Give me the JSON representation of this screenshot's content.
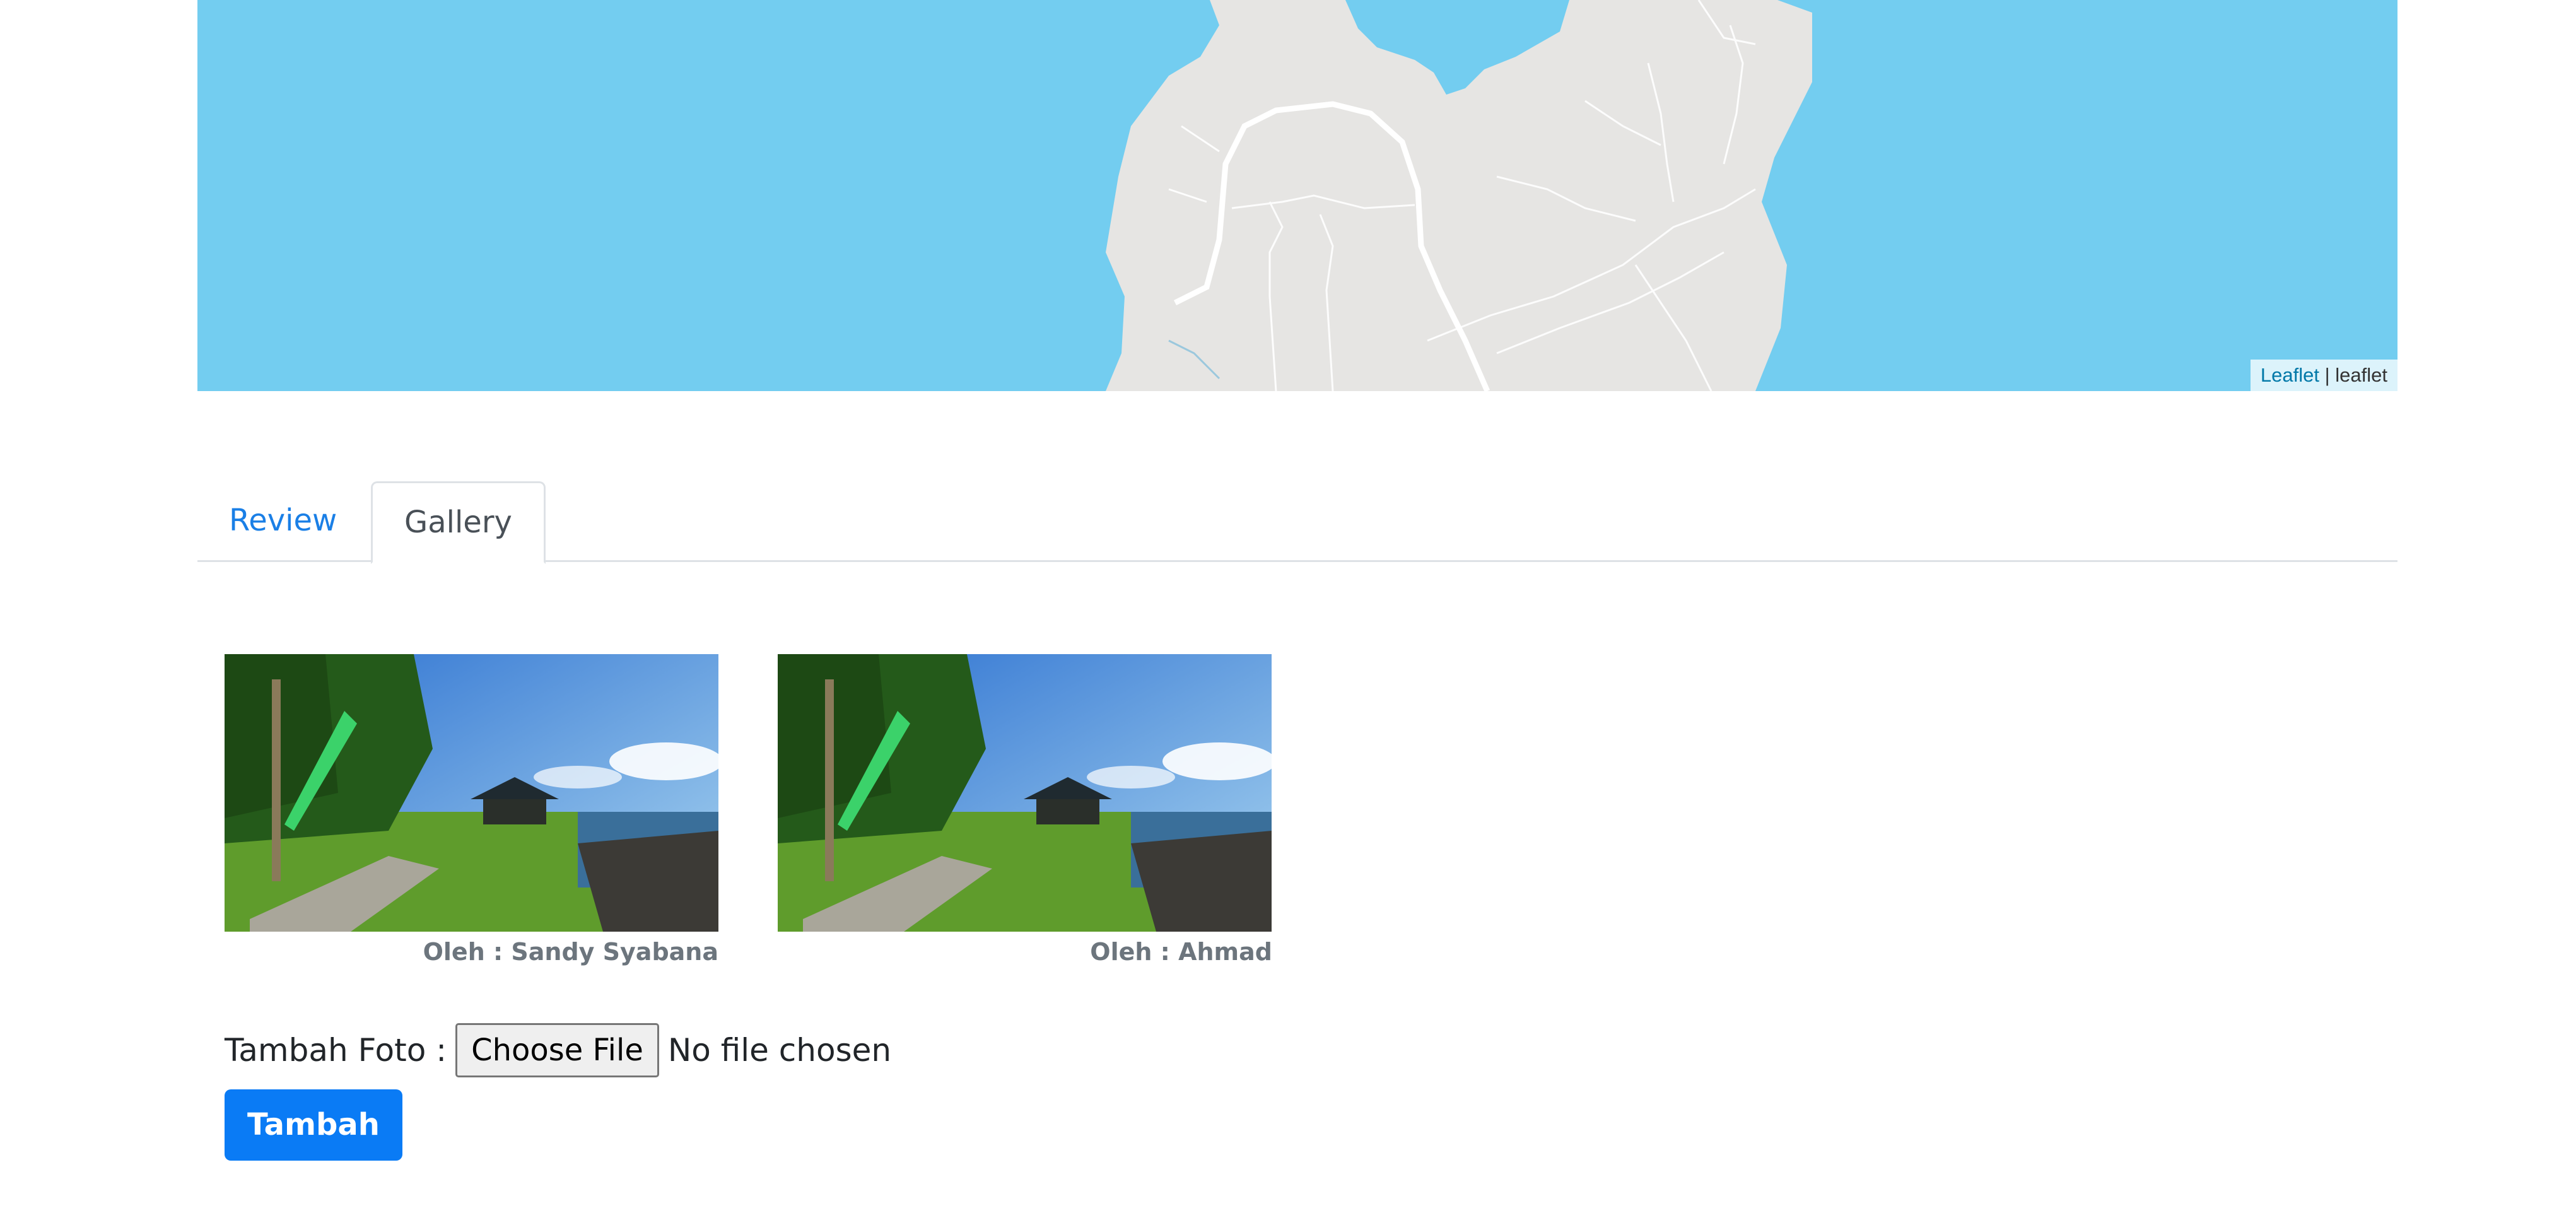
{
  "map": {
    "attribution_link": "Leaflet",
    "attribution_separator": "|",
    "attribution_text": "leaflet"
  },
  "tabs": [
    {
      "label": "Review",
      "active": false
    },
    {
      "label": "Gallery",
      "active": true
    }
  ],
  "gallery": [
    {
      "caption": "Oleh : Sandy Syabana"
    },
    {
      "caption": "Oleh : Ahmad"
    }
  ],
  "upload": {
    "label": "Tambah Foto :",
    "choose_button": "Choose File",
    "status": "No file chosen",
    "submit": "Tambah"
  },
  "colors": {
    "water": "#73cdf0",
    "land": "#e6e5e3",
    "primary": "#0a7bf5"
  }
}
